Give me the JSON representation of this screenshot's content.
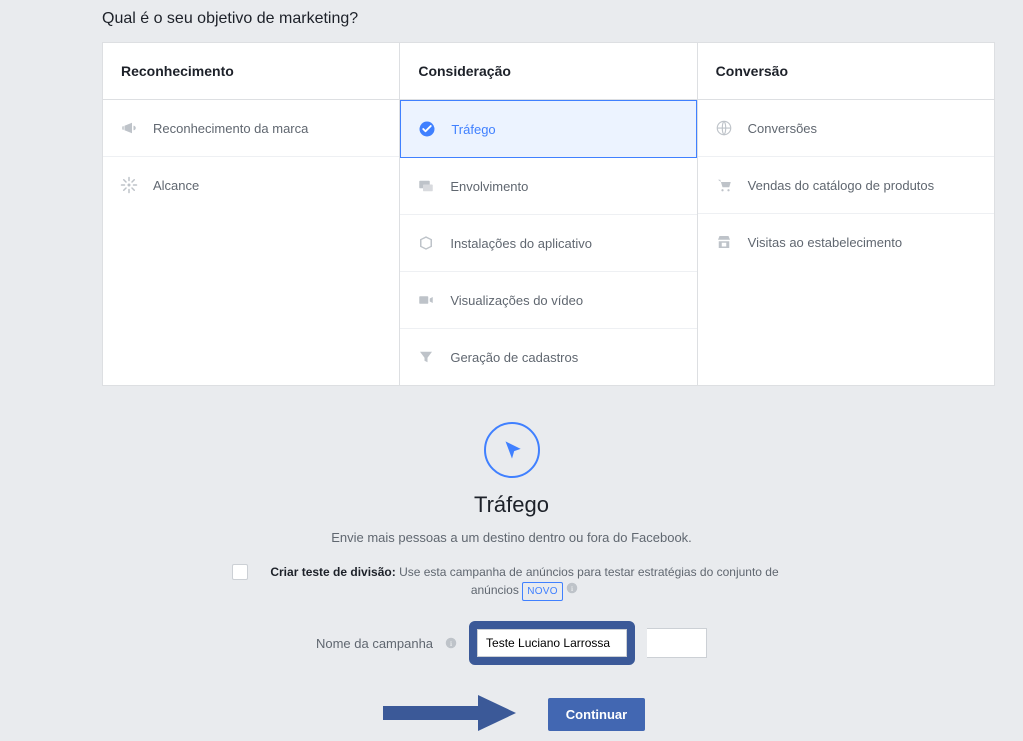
{
  "page_title": "Qual é o seu objetivo de marketing?",
  "columns": {
    "awareness": {
      "header": "Reconhecimento",
      "items": [
        {
          "label": "Reconhecimento da marca"
        },
        {
          "label": "Alcance"
        }
      ]
    },
    "consideration": {
      "header": "Consideração",
      "items": [
        {
          "label": "Tráfego",
          "selected": true
        },
        {
          "label": "Envolvimento"
        },
        {
          "label": "Instalações do aplicativo"
        },
        {
          "label": "Visualizações do vídeo"
        },
        {
          "label": "Geração de cadastros"
        }
      ]
    },
    "conversion": {
      "header": "Conversão",
      "items": [
        {
          "label": "Conversões"
        },
        {
          "label": "Vendas do catálogo de produtos"
        },
        {
          "label": "Visitas ao estabelecimento"
        }
      ]
    }
  },
  "detail": {
    "title": "Tráfego",
    "description": "Envie mais pessoas a um destino dentro ou fora do Facebook.",
    "split_test_bold": "Criar teste de divisão:",
    "split_test_text": " Use esta campanha de anúncios para testar estratégias do conjunto de anúncios ",
    "novo_badge": "NOVO",
    "campaign_name_label": "Nome da campanha",
    "campaign_name_value": "Teste Luciano Larrossa",
    "continue_button": "Continuar"
  }
}
